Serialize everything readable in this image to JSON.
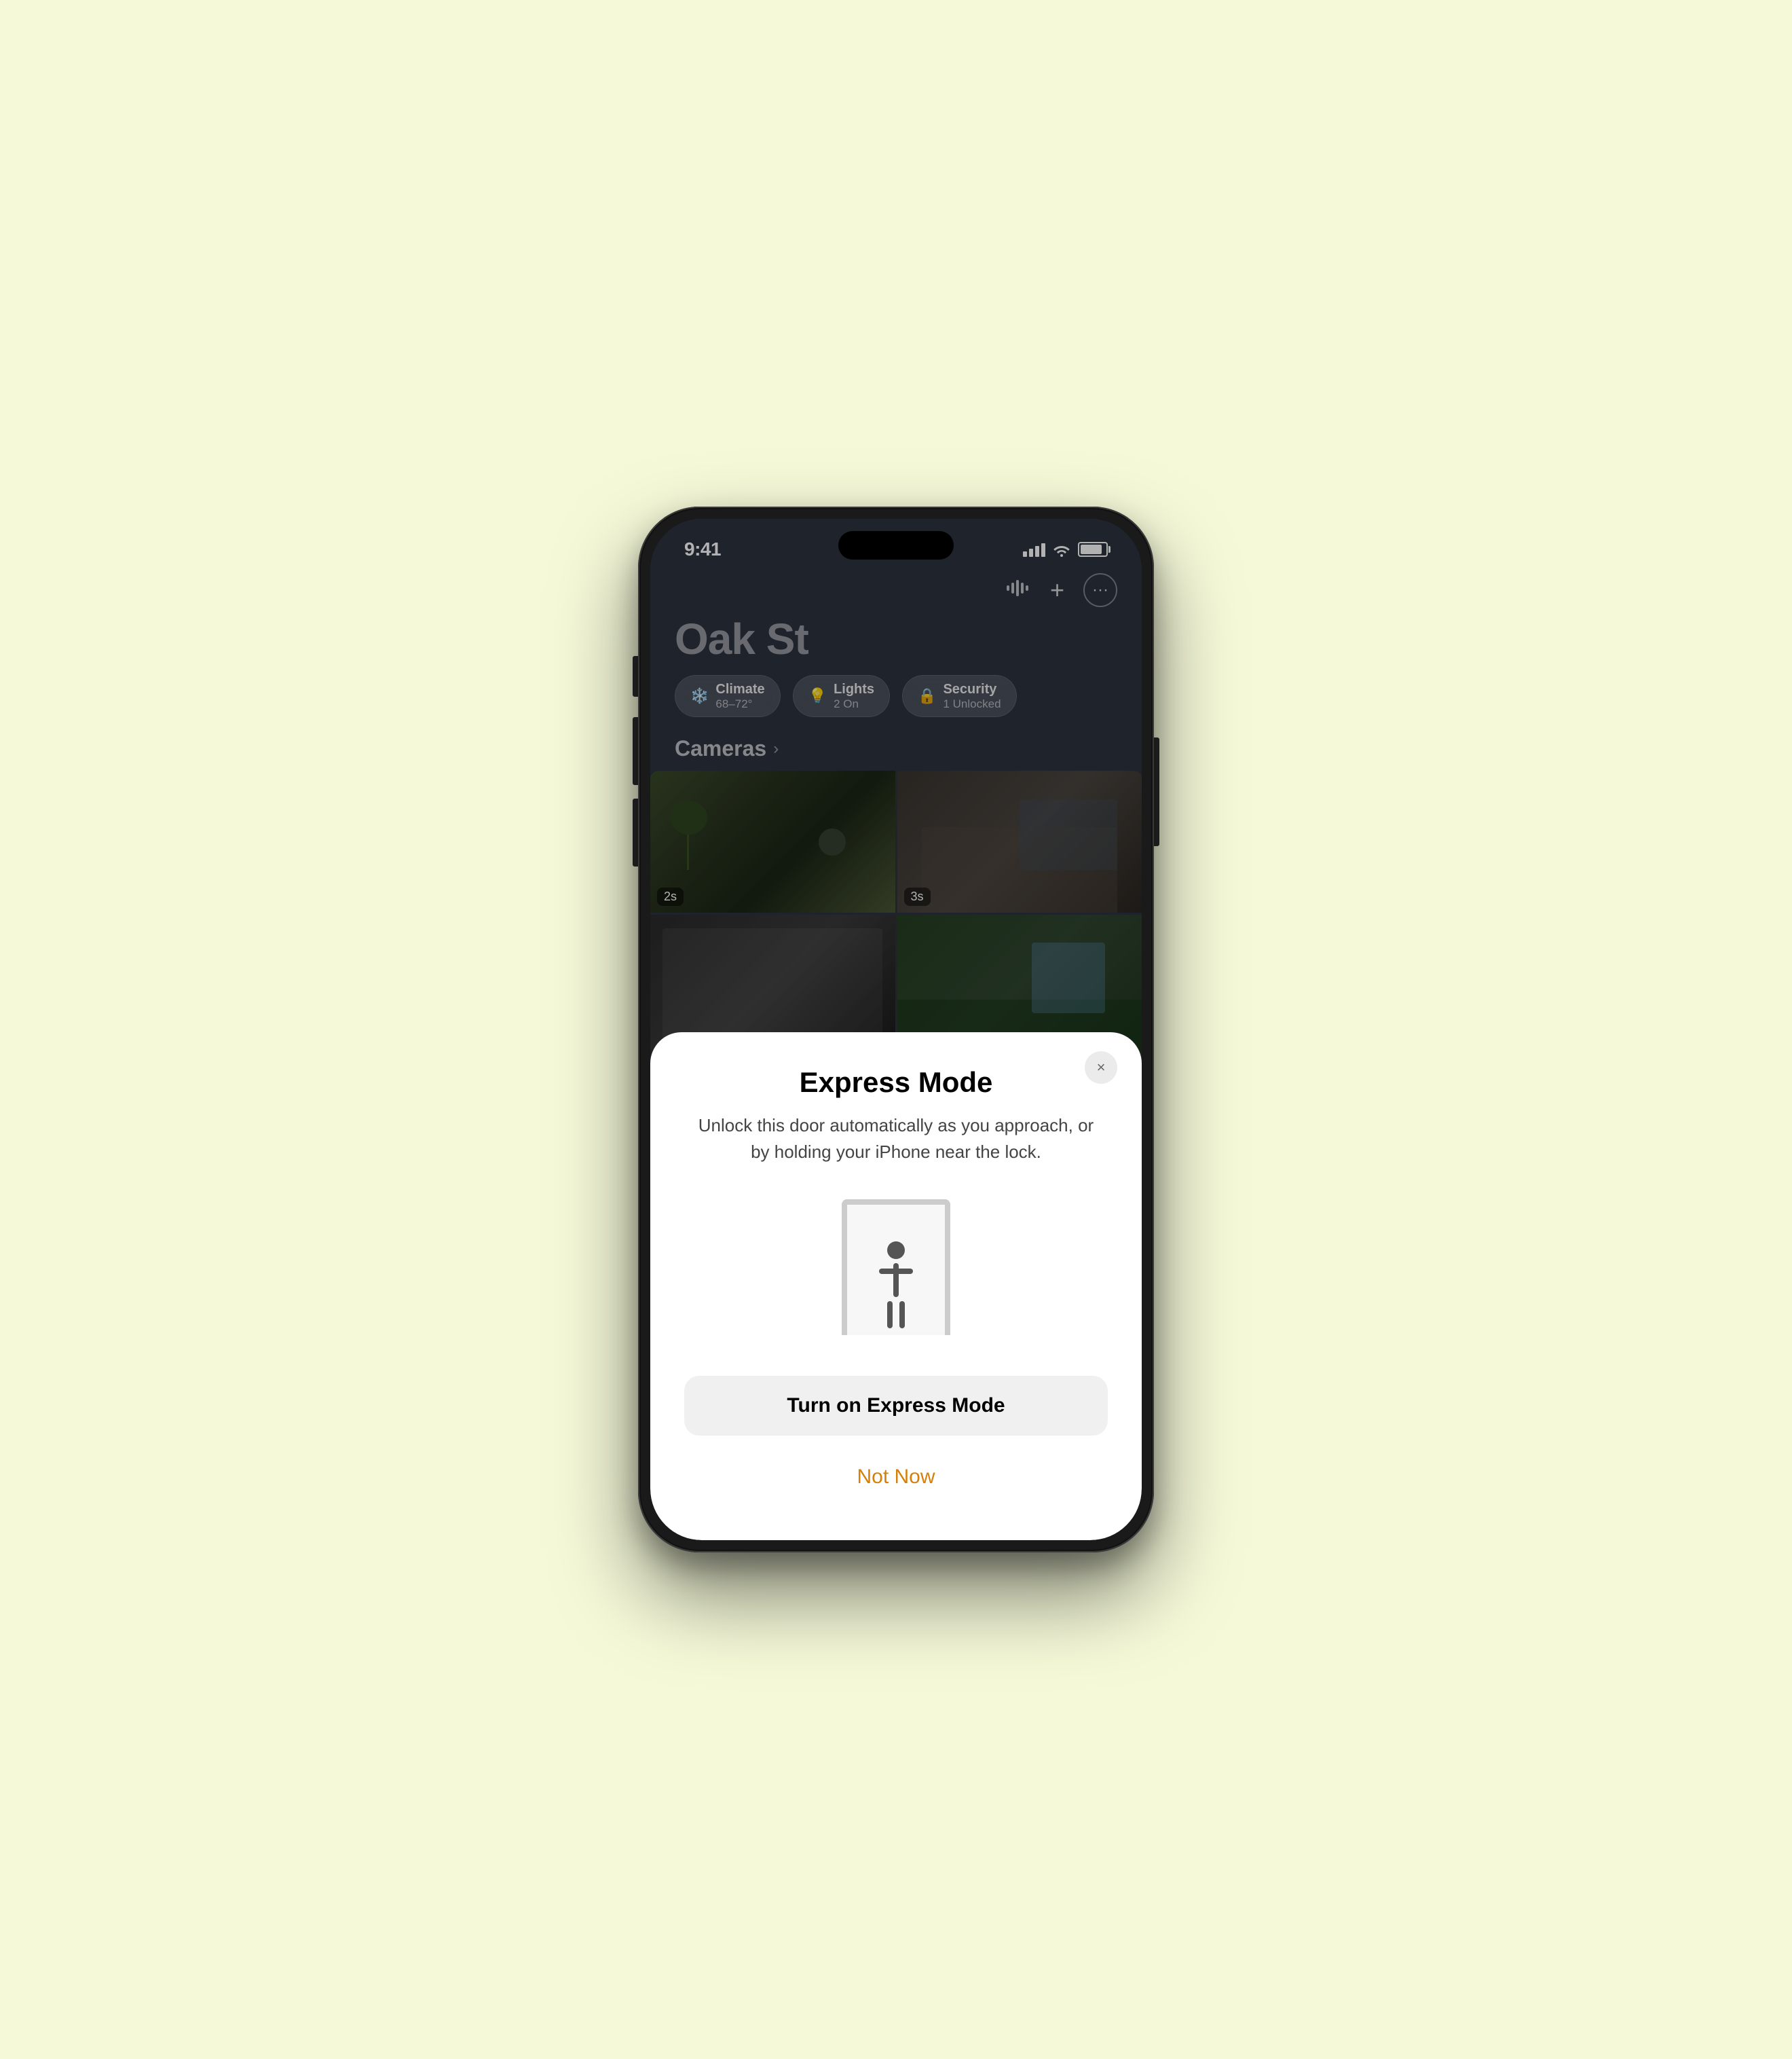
{
  "bg_color": "#f5f9d8",
  "status_bar": {
    "time": "9:41",
    "signal_bars": 4,
    "wifi": true,
    "battery": 85
  },
  "toolbar": {
    "waveform_icon": "waveform-icon",
    "plus_icon": "plus-icon",
    "more_icon": "ellipsis-icon"
  },
  "page": {
    "title": "Oak St"
  },
  "pills": [
    {
      "id": "climate",
      "icon": "❄️",
      "label": "Climate",
      "sub": "68–72°"
    },
    {
      "id": "lights",
      "icon": "💡",
      "label": "Lights",
      "sub": "2 On"
    },
    {
      "id": "security",
      "icon": "🔒",
      "label": "Security",
      "sub": "1 Unlocked"
    }
  ],
  "cameras": {
    "section_title": "Cameras",
    "cells": [
      {
        "id": "cam1",
        "timestamp": "2s"
      },
      {
        "id": "cam2",
        "timestamp": "3s"
      },
      {
        "id": "cam3",
        "timestamp": ""
      },
      {
        "id": "cam4",
        "timestamp": ""
      }
    ]
  },
  "modal": {
    "title": "Express Mode",
    "description": "Unlock this door automatically as you approach, or by holding your iPhone near the lock.",
    "close_label": "×",
    "turn_on_label": "Turn on Express Mode",
    "not_now_label": "Not Now"
  }
}
